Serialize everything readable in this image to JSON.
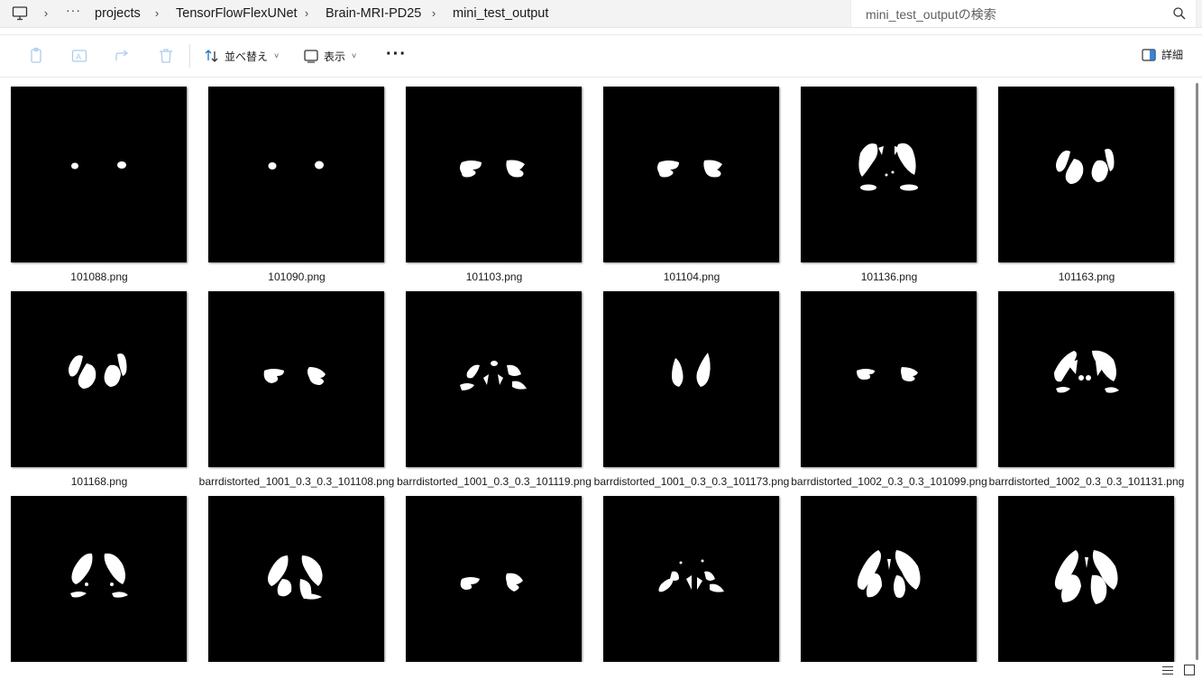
{
  "breadcrumb": {
    "items": [
      "projects",
      "TensorFlowFlexUNet",
      "Brain-MRI-PD25",
      "mini_test_output"
    ]
  },
  "search": {
    "placeholder": "mini_test_outputの検索"
  },
  "toolbar": {
    "sort_label": "並べ替え",
    "view_label": "表示",
    "details_label": "詳細"
  },
  "files": [
    {
      "name": "101088.png"
    },
    {
      "name": "101090.png"
    },
    {
      "name": "101103.png"
    },
    {
      "name": "101104.png"
    },
    {
      "name": "101136.png"
    },
    {
      "name": "101163.png"
    },
    {
      "name": "101168.png"
    },
    {
      "name": "barrdistorted_1001_0.3_0.3_101108.png"
    },
    {
      "name": "barrdistorted_1001_0.3_0.3_101119.png"
    },
    {
      "name": "barrdistorted_1001_0.3_0.3_101173.png"
    },
    {
      "name": "barrdistorted_1002_0.3_0.3_101099.png"
    },
    {
      "name": "barrdistorted_1002_0.3_0.3_101131.png"
    },
    {
      "name": ""
    },
    {
      "name": ""
    },
    {
      "name": ""
    },
    {
      "name": ""
    },
    {
      "name": ""
    },
    {
      "name": ""
    }
  ],
  "icons": {
    "pc": "computer-icon",
    "search": "search-icon",
    "copy": "copy-icon",
    "rename": "rename-icon",
    "share": "share-icon",
    "delete": "delete-icon",
    "sort": "sort-icon",
    "view": "view-icon",
    "details": "details-pane-icon"
  }
}
